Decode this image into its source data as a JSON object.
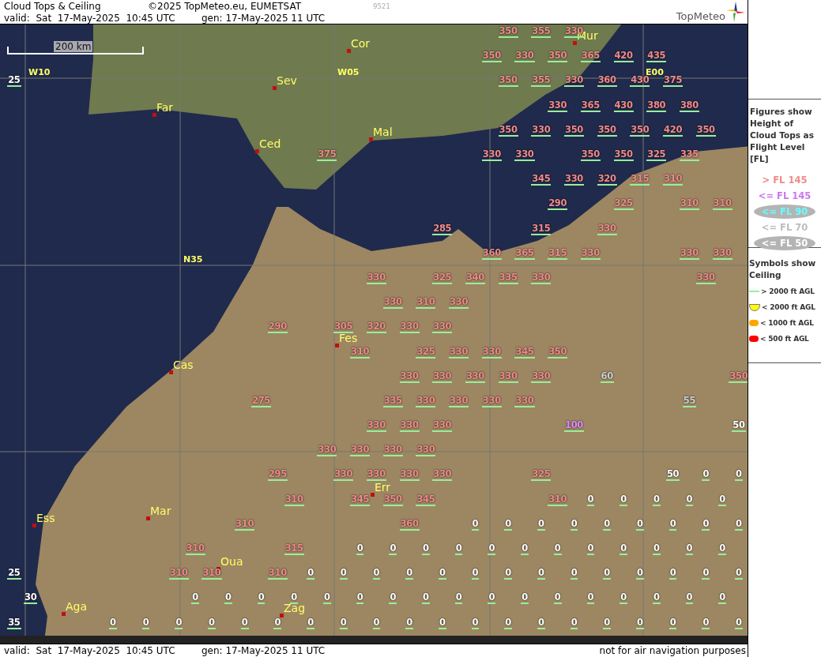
{
  "header": {
    "title": "Cloud Tops & Ceiling",
    "copyright": "©2025 TopMeteo.eu, EUMETSAT",
    "code": "9521",
    "valid": "valid:  Sat  17-May-2025  10:45 UTC",
    "generated": "gen: 17-May-2025 11 UTC",
    "logo": "TopMeteo"
  },
  "map": {
    "scale": "200 km",
    "grid_labels": [
      "W10",
      "W05",
      "E00",
      "N35"
    ],
    "places": [
      {
        "name": "Cor"
      },
      {
        "name": "Mur"
      },
      {
        "name": "Sev"
      },
      {
        "name": "Far"
      },
      {
        "name": "Mal"
      },
      {
        "name": "Ced"
      },
      {
        "name": "Fes"
      },
      {
        "name": "Cas"
      },
      {
        "name": "Err"
      },
      {
        "name": "Mar"
      },
      {
        "name": "Ess"
      },
      {
        "name": "Oua"
      },
      {
        "name": "Aga"
      },
      {
        "name": "Zag"
      }
    ],
    "rows": [
      {
        "cells": [
          null,
          null,
          null,
          null,
          null,
          null,
          null,
          null,
          null,
          null,
          null,
          null,
          null,
          null,
          null,
          {
            "value": "350",
            "color": "#f08a8a"
          },
          {
            "value": "355",
            "color": "#f08a8a"
          },
          {
            "value": "330",
            "color": "#f08a8a"
          }
        ]
      },
      {
        "cells": [
          null,
          null,
          null,
          null,
          null,
          null,
          null,
          null,
          null,
          null,
          null,
          null,
          null,
          null,
          {
            "value": "350",
            "color": "#f08a8a"
          },
          {
            "value": "330",
            "color": "#f08a8a"
          },
          {
            "value": "350",
            "color": "#f08a8a"
          },
          {
            "value": "365",
            "color": "#f08a8a"
          },
          {
            "value": "420",
            "color": "#f08a8a"
          },
          {
            "value": "435",
            "color": "#f08a8a"
          }
        ]
      },
      {
        "cells": [
          {
            "value": "25",
            "color": "#ffffff"
          },
          null,
          null,
          null,
          null,
          null,
          null,
          null,
          null,
          null,
          null,
          null,
          null,
          null,
          null,
          {
            "value": "350",
            "color": "#f08a8a"
          },
          {
            "value": "355",
            "color": "#f08a8a"
          },
          {
            "value": "330",
            "color": "#f08a8a"
          },
          {
            "value": "360",
            "color": "#f08a8a"
          },
          {
            "value": "430",
            "color": "#f08a8a"
          },
          {
            "value": "375",
            "color": "#f08a8a"
          }
        ]
      },
      {
        "cells": [
          null,
          null,
          null,
          null,
          null,
          null,
          null,
          null,
          null,
          null,
          null,
          null,
          null,
          null,
          null,
          null,
          {
            "value": "330",
            "color": "#f08a8a"
          },
          {
            "value": "365",
            "color": "#f08a8a"
          },
          {
            "value": "430",
            "color": "#f08a8a"
          },
          {
            "value": "380",
            "color": "#f08a8a"
          },
          {
            "value": "380",
            "color": "#f08a8a"
          }
        ]
      },
      {
        "cells": [
          null,
          null,
          null,
          null,
          null,
          null,
          null,
          null,
          null,
          null,
          null,
          null,
          null,
          null,
          null,
          {
            "value": "350",
            "color": "#f08a8a"
          },
          {
            "value": "330",
            "color": "#f08a8a"
          },
          {
            "value": "350",
            "color": "#f08a8a"
          },
          {
            "value": "350",
            "color": "#f08a8a"
          },
          {
            "value": "350",
            "color": "#f08a8a"
          },
          {
            "value": "420",
            "color": "#f08a8a"
          },
          {
            "value": "350",
            "color": "#f08a8a"
          }
        ]
      },
      {
        "cells": [
          null,
          null,
          null,
          null,
          null,
          null,
          null,
          null,
          null,
          {
            "value": "375",
            "color": "#f08a8a"
          },
          null,
          null,
          null,
          null,
          {
            "value": "330",
            "color": "#f08a8a"
          },
          {
            "value": "330",
            "color": "#f08a8a"
          },
          null,
          {
            "value": "350",
            "color": "#f08a8a"
          },
          {
            "value": "350",
            "color": "#f08a8a"
          },
          {
            "value": "325",
            "color": "#f08a8a"
          },
          {
            "value": "335",
            "color": "#f08a8a"
          }
        ]
      },
      {
        "cells": [
          null,
          null,
          null,
          null,
          null,
          null,
          null,
          null,
          null,
          null,
          null,
          null,
          null,
          null,
          null,
          null,
          {
            "value": "345",
            "color": "#f08a8a"
          },
          {
            "value": "330",
            "color": "#f08a8a"
          },
          {
            "value": "320",
            "color": "#f08a8a"
          },
          {
            "value": "315",
            "color": "#f08a8a"
          },
          {
            "value": "310",
            "color": "#f08a8a"
          }
        ]
      },
      {
        "cells": [
          null,
          null,
          null,
          null,
          null,
          null,
          null,
          null,
          null,
          null,
          null,
          null,
          null,
          null,
          null,
          null,
          {
            "value": "290",
            "color": "#f08a8a"
          },
          null,
          {
            "value": "325",
            "color": "#f08a8a"
          },
          null,
          {
            "value": "310",
            "color": "#f08a8a"
          },
          {
            "value": "310",
            "color": "#f08a8a"
          }
        ]
      },
      {
        "cells": [
          null,
          null,
          null,
          null,
          null,
          null,
          null,
          null,
          null,
          null,
          null,
          null,
          null,
          {
            "value": "285",
            "color": "#f08a8a"
          },
          null,
          null,
          {
            "value": "315",
            "color": "#f08a8a"
          },
          null,
          {
            "value": "330",
            "color": "#f08a8a"
          }
        ]
      },
      {
        "cells": [
          null,
          null,
          null,
          null,
          null,
          null,
          null,
          null,
          null,
          null,
          null,
          null,
          null,
          null,
          {
            "value": "360",
            "color": "#f08a8a"
          },
          {
            "value": "365",
            "color": "#f08a8a"
          },
          {
            "value": "315",
            "color": "#f08a8a"
          },
          {
            "value": "330",
            "color": "#f08a8a"
          },
          null,
          null,
          {
            "value": "330",
            "color": "#f08a8a"
          },
          {
            "value": "330",
            "color": "#f08a8a"
          }
        ]
      },
      {
        "cells": [
          null,
          null,
          null,
          null,
          null,
          null,
          null,
          null,
          null,
          null,
          null,
          {
            "value": "330",
            "color": "#f08a8a"
          },
          null,
          {
            "value": "325",
            "color": "#f08a8a"
          },
          {
            "value": "340",
            "color": "#f08a8a"
          },
          {
            "value": "335",
            "color": "#f08a8a"
          },
          {
            "value": "330",
            "color": "#f08a8a"
          },
          null,
          null,
          null,
          null,
          {
            "value": "330",
            "color": "#f08a8a"
          }
        ]
      },
      {
        "cells": [
          null,
          null,
          null,
          null,
          null,
          null,
          null,
          null,
          null,
          null,
          null,
          {
            "value": "330",
            "color": "#f08a8a"
          },
          {
            "value": "310",
            "color": "#f08a8a"
          },
          {
            "value": "330",
            "color": "#f08a8a"
          }
        ]
      },
      {
        "cells": [
          null,
          null,
          null,
          null,
          null,
          null,
          null,
          null,
          {
            "value": "290",
            "color": "#f08a8a"
          },
          null,
          {
            "value": "305",
            "color": "#f08a8a"
          },
          {
            "value": "320",
            "color": "#f08a8a"
          },
          {
            "value": "330",
            "color": "#f08a8a"
          },
          {
            "value": "330",
            "color": "#f08a8a"
          }
        ]
      },
      {
        "cells": [
          null,
          null,
          null,
          null,
          null,
          null,
          null,
          null,
          null,
          null,
          {
            "value": "310",
            "color": "#f08a8a"
          },
          null,
          {
            "value": "325",
            "color": "#f08a8a"
          },
          {
            "value": "330",
            "color": "#f08a8a"
          },
          {
            "value": "330",
            "color": "#f08a8a"
          },
          {
            "value": "345",
            "color": "#f08a8a"
          },
          {
            "value": "350",
            "color": "#f08a8a"
          }
        ]
      },
      {
        "cells": [
          null,
          null,
          null,
          null,
          null,
          null,
          null,
          null,
          null,
          null,
          null,
          null,
          {
            "value": "330",
            "color": "#f08a8a"
          },
          {
            "value": "330",
            "color": "#f08a8a"
          },
          {
            "value": "330",
            "color": "#f08a8a"
          },
          {
            "value": "330",
            "color": "#f08a8a"
          },
          {
            "value": "330",
            "color": "#f08a8a"
          },
          null,
          {
            "value": "60",
            "color": "#cfcfcf"
          },
          null,
          null,
          null,
          {
            "value": "350",
            "color": "#f08a8a"
          }
        ]
      },
      {
        "cells": [
          null,
          null,
          null,
          null,
          null,
          null,
          null,
          {
            "value": "275",
            "color": "#f08a8a"
          },
          null,
          null,
          null,
          {
            "value": "335",
            "color": "#f08a8a"
          },
          {
            "value": "330",
            "color": "#f08a8a"
          },
          {
            "value": "330",
            "color": "#f08a8a"
          },
          {
            "value": "330",
            "color": "#f08a8a"
          },
          {
            "value": "330",
            "color": "#f08a8a"
          },
          null,
          null,
          null,
          null,
          {
            "value": "55",
            "color": "#cfcfcf"
          }
        ]
      },
      {
        "cells": [
          null,
          null,
          null,
          null,
          null,
          null,
          null,
          null,
          null,
          null,
          null,
          {
            "value": "330",
            "color": "#f08a8a"
          },
          {
            "value": "330",
            "color": "#f08a8a"
          },
          {
            "value": "330",
            "color": "#f08a8a"
          },
          null,
          null,
          null,
          {
            "value": "100",
            "color": "#e08cff"
          },
          null,
          null,
          null,
          null,
          {
            "value": "50",
            "color": "#ffffff"
          }
        ]
      },
      {
        "cells": [
          null,
          null,
          null,
          null,
          null,
          null,
          null,
          null,
          null,
          {
            "value": "330",
            "color": "#f08a8a"
          },
          {
            "value": "330",
            "color": "#f08a8a"
          },
          {
            "value": "330",
            "color": "#f08a8a"
          },
          {
            "value": "330",
            "color": "#f08a8a"
          }
        ]
      },
      {
        "cells": [
          null,
          null,
          null,
          null,
          null,
          null,
          null,
          null,
          {
            "value": "295",
            "color": "#f08a8a"
          },
          null,
          {
            "value": "330",
            "color": "#f08a8a"
          },
          {
            "value": "330",
            "color": "#f08a8a"
          },
          {
            "value": "330",
            "color": "#f08a8a"
          },
          {
            "value": "330",
            "color": "#f08a8a"
          },
          null,
          null,
          {
            "value": "325",
            "color": "#f08a8a"
          },
          null,
          null,
          null,
          {
            "value": "50",
            "color": "#ffffff"
          },
          {
            "value": "0",
            "color": "#ffffff"
          },
          {
            "value": "0",
            "color": "#ffffff"
          }
        ]
      },
      {
        "cells": [
          null,
          null,
          null,
          null,
          null,
          null,
          null,
          null,
          {
            "value": "310",
            "color": "#f08a8a"
          },
          null,
          {
            "value": "345",
            "color": "#f08a8a"
          },
          {
            "value": "350",
            "color": "#f08a8a"
          },
          {
            "value": "345",
            "color": "#f08a8a"
          },
          null,
          null,
          null,
          {
            "value": "310",
            "color": "#f08a8a"
          },
          {
            "value": "0",
            "color": "#ffffff"
          },
          {
            "value": "0",
            "color": "#ffffff"
          },
          {
            "value": "0",
            "color": "#ffffff"
          },
          {
            "value": "0",
            "color": "#ffffff"
          },
          {
            "value": "0",
            "color": "#ffffff"
          }
        ]
      },
      {
        "cells": [
          null,
          null,
          null,
          null,
          null,
          null,
          null,
          {
            "value": "310",
            "color": "#f08a8a"
          },
          null,
          null,
          null,
          null,
          {
            "value": "360",
            "color": "#f08a8a"
          },
          null,
          {
            "value": "0",
            "color": "#ffffff"
          },
          {
            "value": "0",
            "color": "#ffffff"
          },
          {
            "value": "0",
            "color": "#ffffff"
          },
          {
            "value": "0",
            "color": "#ffffff"
          },
          {
            "value": "0",
            "color": "#ffffff"
          },
          {
            "value": "0",
            "color": "#ffffff"
          },
          {
            "value": "0",
            "color": "#ffffff"
          },
          {
            "value": "0",
            "color": "#ffffff"
          },
          {
            "value": "0",
            "color": "#ffffff"
          }
        ]
      },
      {
        "cells": [
          null,
          null,
          null,
          null,
          null,
          {
            "value": "310",
            "color": "#f08a8a"
          },
          null,
          null,
          {
            "value": "315",
            "color": "#f08a8a"
          },
          null,
          {
            "value": "0",
            "color": "#ffffff"
          },
          {
            "value": "0",
            "color": "#ffffff"
          },
          {
            "value": "0",
            "color": "#ffffff"
          },
          {
            "value": "0",
            "color": "#ffffff"
          },
          {
            "value": "0",
            "color": "#ffffff"
          },
          {
            "value": "0",
            "color": "#ffffff"
          },
          {
            "value": "0",
            "color": "#ffffff"
          },
          {
            "value": "0",
            "color": "#ffffff"
          },
          {
            "value": "0",
            "color": "#ffffff"
          },
          {
            "value": "0",
            "color": "#ffffff"
          },
          {
            "value": "0",
            "color": "#ffffff"
          },
          {
            "value": "0",
            "color": "#ffffff"
          }
        ]
      },
      {
        "cells": [
          {
            "value": "25",
            "color": "#ffffff"
          },
          null,
          null,
          null,
          null,
          {
            "value": "310",
            "color": "#f08a8a"
          },
          {
            "value": "310",
            "color": "#f08a8a"
          },
          null,
          {
            "value": "310",
            "color": "#f08a8a"
          },
          {
            "value": "0",
            "color": "#ffffff"
          },
          {
            "value": "0",
            "color": "#ffffff"
          },
          {
            "value": "0",
            "color": "#ffffff"
          },
          {
            "value": "0",
            "color": "#ffffff"
          },
          {
            "value": "0",
            "color": "#ffffff"
          },
          {
            "value": "0",
            "color": "#ffffff"
          },
          {
            "value": "0",
            "color": "#ffffff"
          },
          {
            "value": "0",
            "color": "#ffffff"
          },
          {
            "value": "0",
            "color": "#ffffff"
          },
          {
            "value": "0",
            "color": "#ffffff"
          },
          {
            "value": "0",
            "color": "#ffffff"
          },
          {
            "value": "0",
            "color": "#ffffff"
          },
          {
            "value": "0",
            "color": "#ffffff"
          },
          {
            "value": "0",
            "color": "#ffffff"
          }
        ]
      },
      {
        "cells": [
          {
            "value": "30",
            "color": "#ffffff"
          },
          null,
          null,
          null,
          null,
          {
            "value": "0",
            "color": "#ffffff"
          },
          {
            "value": "0",
            "color": "#ffffff"
          },
          {
            "value": "0",
            "color": "#ffffff"
          },
          {
            "value": "0",
            "color": "#ffffff"
          },
          {
            "value": "0",
            "color": "#ffffff"
          },
          {
            "value": "0",
            "color": "#ffffff"
          },
          {
            "value": "0",
            "color": "#ffffff"
          },
          {
            "value": "0",
            "color": "#ffffff"
          },
          {
            "value": "0",
            "color": "#ffffff"
          },
          {
            "value": "0",
            "color": "#ffffff"
          },
          {
            "value": "0",
            "color": "#ffffff"
          },
          {
            "value": "0",
            "color": "#ffffff"
          },
          {
            "value": "0",
            "color": "#ffffff"
          },
          {
            "value": "0",
            "color": "#ffffff"
          },
          {
            "value": "0",
            "color": "#ffffff"
          },
          {
            "value": "0",
            "color": "#ffffff"
          },
          {
            "value": "0",
            "color": "#ffffff"
          }
        ]
      },
      {
        "cells": [
          {
            "value": "35",
            "color": "#ffffff"
          },
          null,
          null,
          {
            "value": "0",
            "color": "#ffffff"
          },
          {
            "value": "0",
            "color": "#ffffff"
          },
          {
            "value": "0",
            "color": "#ffffff"
          },
          {
            "value": "0",
            "color": "#ffffff"
          },
          {
            "value": "0",
            "color": "#ffffff"
          },
          {
            "value": "0",
            "color": "#ffffff"
          },
          {
            "value": "0",
            "color": "#ffffff"
          },
          {
            "value": "0",
            "color": "#ffffff"
          },
          {
            "value": "0",
            "color": "#ffffff"
          },
          {
            "value": "0",
            "color": "#ffffff"
          },
          {
            "value": "0",
            "color": "#ffffff"
          },
          {
            "value": "0",
            "color": "#ffffff"
          },
          {
            "value": "0",
            "color": "#ffffff"
          },
          {
            "value": "0",
            "color": "#ffffff"
          },
          {
            "value": "0",
            "color": "#ffffff"
          },
          {
            "value": "0",
            "color": "#ffffff"
          },
          {
            "value": "0",
            "color": "#ffffff"
          },
          {
            "value": "0",
            "color": "#ffffff"
          },
          {
            "value": "0",
            "color": "#ffffff"
          },
          {
            "value": "0",
            "color": "#ffffff"
          }
        ]
      }
    ]
  },
  "legend": {
    "figures_title": "Figures show Height of Cloud Tops as Flight Level  [FL]",
    "figures": [
      {
        "label": "> FL 145",
        "color": "#f08a8a",
        "highlighted": false
      },
      {
        "label": "<= FL 145",
        "color": "#cc77ee",
        "highlighted": false
      },
      {
        "label": "<= FL 90",
        "color": "#66ffff",
        "highlighted": true
      },
      {
        "label": "<= FL 70",
        "color": "#bdbdbd",
        "highlighted": false
      },
      {
        "label": "<= FL 50",
        "color": "#ffffff",
        "highlighted": true
      }
    ],
    "symbols_title": "Symbols show Ceiling",
    "symbols": [
      {
        "label": "> 2000 ft AGL",
        "color": "#99ee99",
        "kind": "line"
      },
      {
        "label": "< 2000 ft AGL",
        "color": "#ffff00",
        "kind": "bowl"
      },
      {
        "label": "< 1000 ft AGL",
        "color": "#ffa500",
        "kind": "pill"
      },
      {
        "label": "< 500 ft AGL",
        "color": "#ff0000",
        "kind": "pill"
      }
    ]
  },
  "footer": {
    "valid": "valid:  Sat  17-May-2025  10:45 UTC",
    "generated": "gen: 17-May-2025 11 UTC",
    "note": "not for air navigation purposes"
  }
}
